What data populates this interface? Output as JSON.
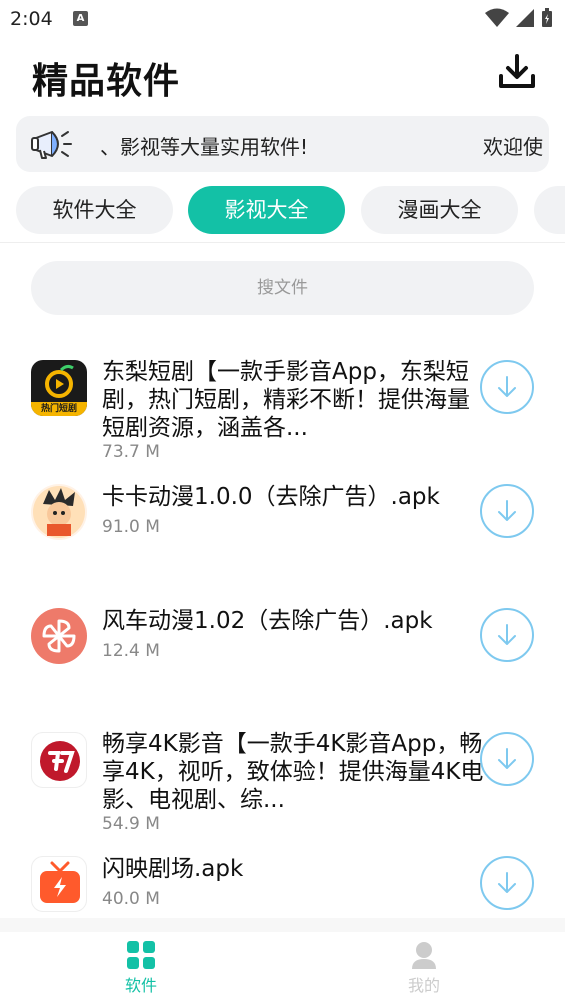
{
  "status_bar": {
    "time": "2:04",
    "notification_letter": "A"
  },
  "header": {
    "title": "精品软件"
  },
  "marquee": {
    "text": "、影视等大量实用软件!",
    "text_continued": "欢迎使"
  },
  "tabs": [
    {
      "label": "软件大全",
      "active": false
    },
    {
      "label": "影视大全",
      "active": true
    },
    {
      "label": "漫画大全",
      "active": false
    },
    {
      "label": "",
      "active": false
    }
  ],
  "search": {
    "placeholder": "搜文件"
  },
  "apps": [
    {
      "name": "东梨短剧【一款手影音App，东梨短剧，热门短剧，精彩不断！提供海量短剧资源，涵盖各...",
      "size": "73.7 M",
      "icon": "dongli-drama-icon",
      "icon_label": "热门短剧"
    },
    {
      "name": "卡卡动漫1.0.0（去除广告）.apk",
      "size": "91.0 M",
      "icon": "kaka-anime-icon"
    },
    {
      "name": "风车动漫1.02（去除广告）.apk",
      "size": "12.4 M",
      "icon": "windmill-anime-icon"
    },
    {
      "name": "畅享4K影音【一款手4K影音App，畅享4K，视听，致体验！提供海量4K电影、电视剧、综...",
      "size": "54.9 M",
      "icon": "4k-video-icon"
    },
    {
      "name": "闪映剧场.apk",
      "size": "40.0 M",
      "icon": "shanying-theater-icon"
    }
  ],
  "bottom_nav": [
    {
      "label": "软件",
      "active": true
    },
    {
      "label": "我的",
      "active": false
    }
  ],
  "colors": {
    "accent": "#13c1a6",
    "download_ring": "#7ec9ef",
    "pill_bg": "#f1f2f4",
    "inactive_nav": "#cccccc"
  }
}
